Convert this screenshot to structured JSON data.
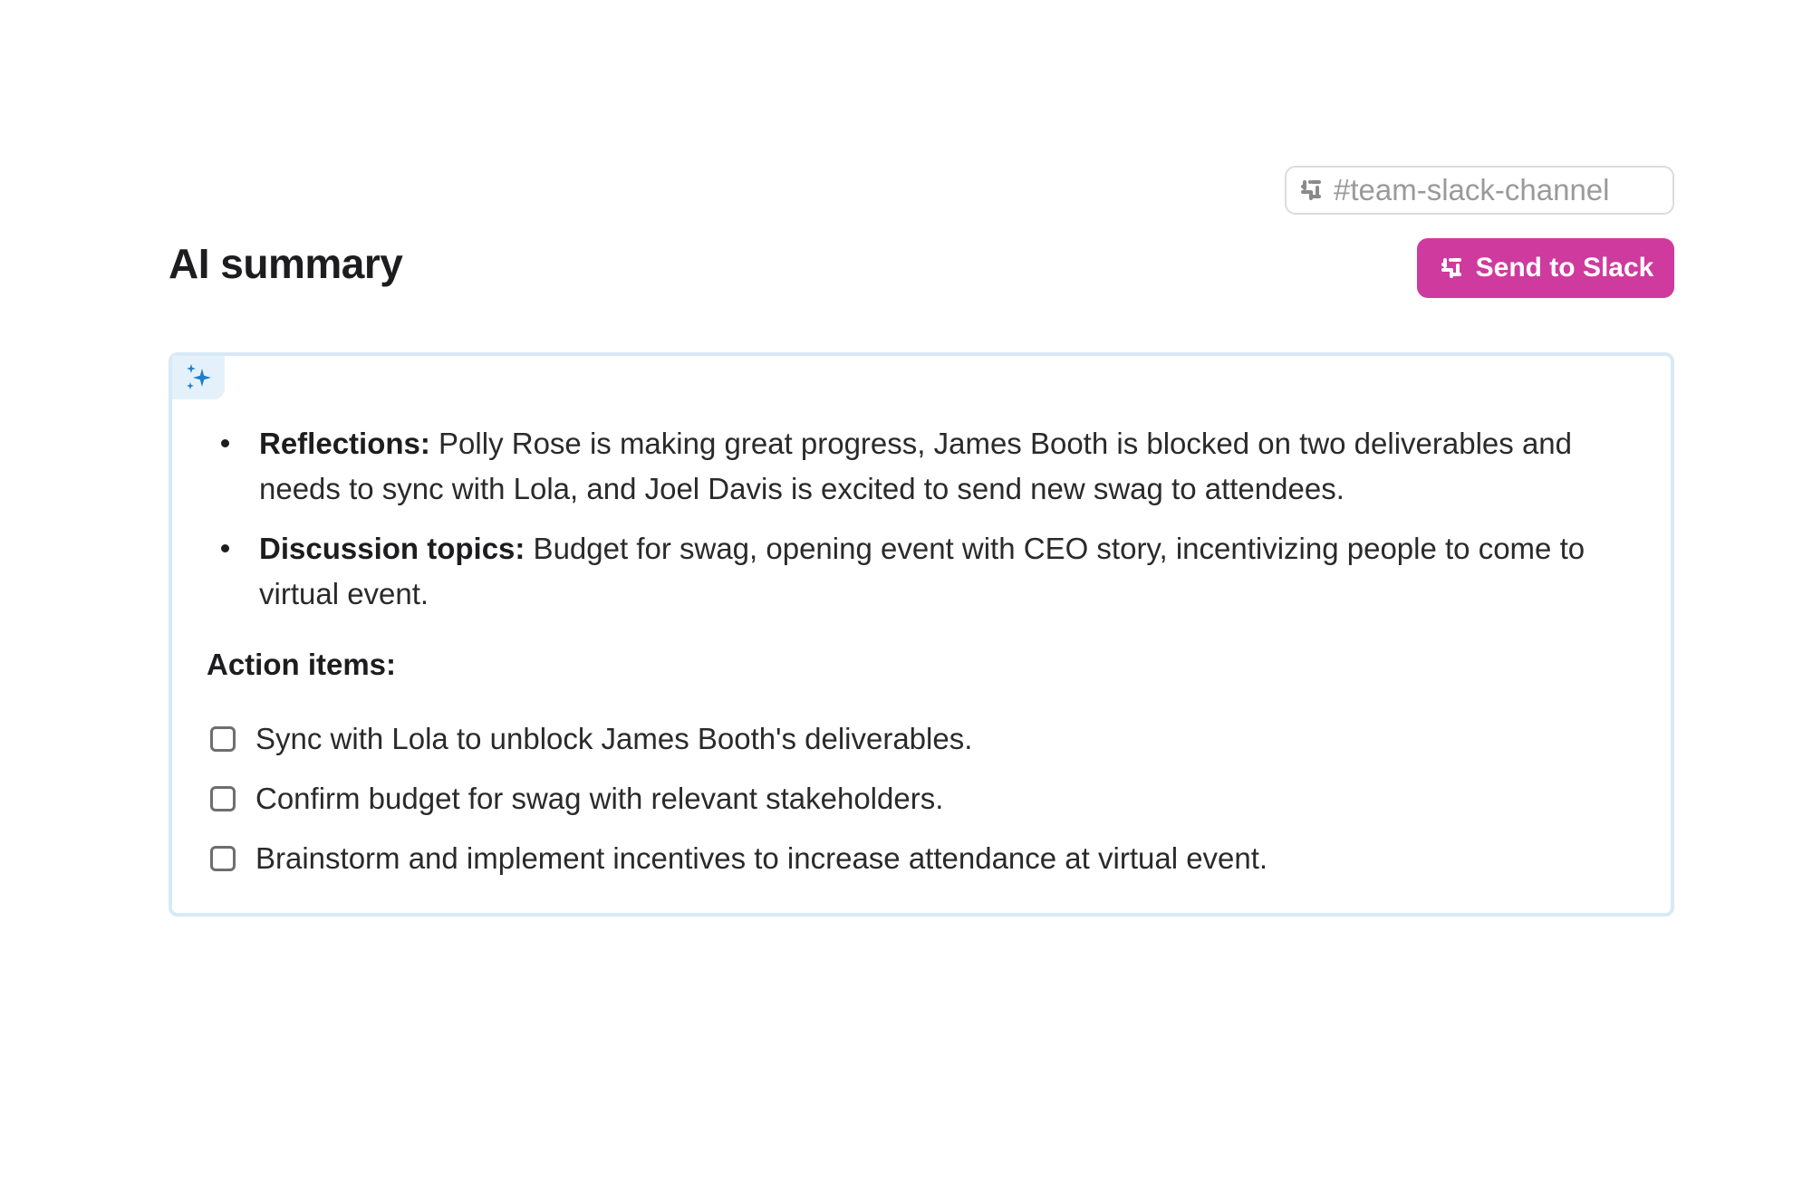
{
  "channel": {
    "placeholder": "#team-slack-channel",
    "icon": "slack-icon"
  },
  "header": {
    "title": "AI summary"
  },
  "send_button": {
    "label": "Send to Slack",
    "color": "#cf3a9e",
    "icon": "slack-icon"
  },
  "summary": {
    "icon": "sparkles-icon",
    "border_color": "#d7e9f7",
    "bullets": [
      {
        "label": "Reflections:",
        "text": " Polly Rose is making great progress, James Booth is blocked on two deliverables and needs to sync with Lola, and Joel Davis is excited to send new swag to attendees."
      },
      {
        "label": "Discussion topics:",
        "text": " Budget for swag, opening event with CEO story, incentivizing people to come to virtual event."
      }
    ],
    "action_heading": "Action items:",
    "action_items": [
      {
        "text": "Sync with Lola to unblock James Booth's deliverables.",
        "checked": false
      },
      {
        "text": "Confirm budget for swag with relevant stakeholders.",
        "checked": false
      },
      {
        "text": "Brainstorm and implement incentives to increase attendance at virtual event.",
        "checked": false
      }
    ]
  }
}
